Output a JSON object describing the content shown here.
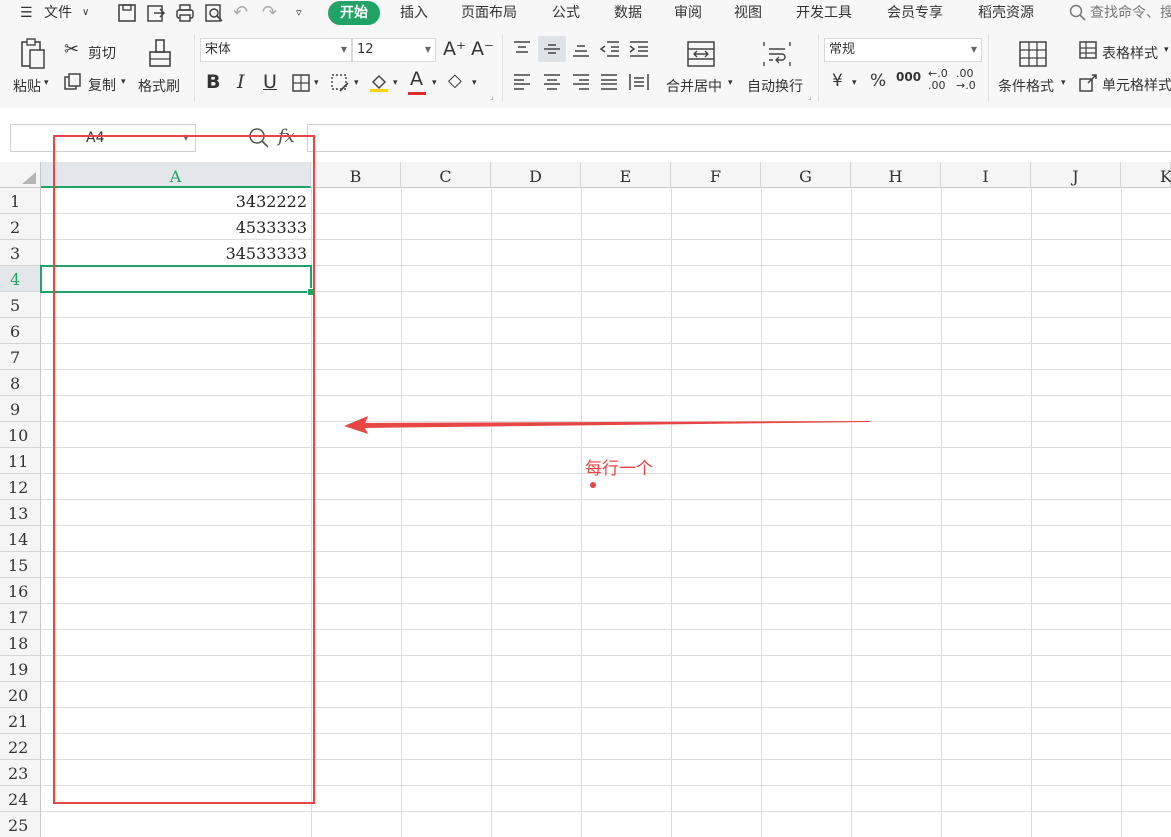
{
  "menubar": {
    "file_label": "文件",
    "tabs": [
      "开始",
      "插入",
      "页面布局",
      "公式",
      "数据",
      "审阅",
      "视图",
      "开发工具",
      "会员专享",
      "稻壳资源"
    ],
    "search_placeholder": "查找命令、搜"
  },
  "ribbon": {
    "paste_label": "粘贴",
    "cut_label": "剪切",
    "copy_label": "复制",
    "format_painter_label": "格式刷",
    "font_name": "宋体",
    "font_size": "12",
    "merge_label": "合并居中",
    "wrap_label": "自动换行",
    "number_format": "常规",
    "currency_symbol": "¥",
    "percent_symbol": "%",
    "thousands_symbol": "000",
    "conditional_format_label": "条件格式",
    "table_style_label": "表格样式",
    "cell_style_label": "单元格样式"
  },
  "formula_bar": {
    "name_box": "A4",
    "fx_label": "fx"
  },
  "sheet": {
    "columns": [
      "A",
      "B",
      "C",
      "D",
      "E",
      "F",
      "G",
      "H",
      "I",
      "J",
      "K"
    ],
    "rows": [
      "1",
      "2",
      "3",
      "4",
      "5",
      "6",
      "7",
      "8",
      "9",
      "10",
      "11",
      "12",
      "13",
      "14",
      "15",
      "16",
      "17",
      "18",
      "19",
      "20",
      "21",
      "22",
      "23",
      "24",
      "25"
    ],
    "cells": {
      "A1": "3432222",
      "A2": "4533333",
      "A3": "34533333"
    },
    "selected_column": "A",
    "selected_row": "4"
  },
  "annotation": {
    "text": "每行一个"
  },
  "colors": {
    "accent": "#21a366",
    "annotation": "#e84545"
  }
}
